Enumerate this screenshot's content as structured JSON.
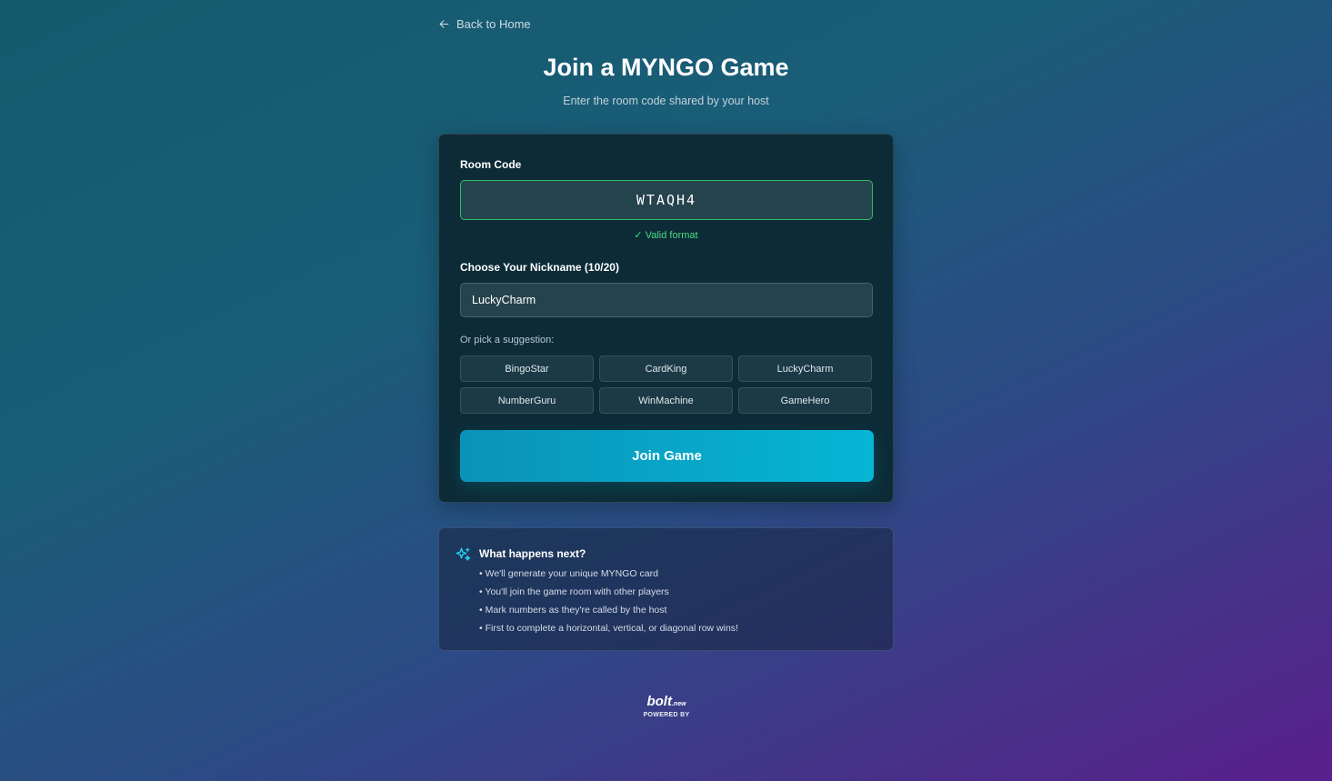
{
  "nav": {
    "back_label": "Back to Home",
    "back_icon": "arrow-left-icon"
  },
  "header": {
    "title": "Join a MYNGO Game",
    "subtitle": "Enter the room code shared by your host"
  },
  "form": {
    "room_code_label": "Room Code",
    "room_code_value": "WTAQH4",
    "valid_message": "✓ Valid format",
    "nickname_label": "Choose Your Nickname (10/20)",
    "nickname_value": "LuckyCharm",
    "suggestion_label": "Or pick a suggestion:",
    "suggestions": [
      "BingoStar",
      "CardKing",
      "LuckyCharm",
      "NumberGuru",
      "WinMachine",
      "GameHero"
    ],
    "join_button": "Join Game"
  },
  "info": {
    "icon": "sparkles-icon",
    "title": "What happens next?",
    "items": [
      "• We'll generate your unique MYNGO card",
      "• You'll join the game room with other players",
      "• Mark numbers as they're called by the host",
      "• First to complete a horizontal, vertical, or diagonal row wins!"
    ]
  },
  "badge": {
    "logo_main": "bolt",
    "logo_sub": ".new",
    "caption": "POWERED BY"
  },
  "colors": {
    "accent": "#06b6d4",
    "valid": "#4ade80",
    "card_bg": "#0c2b37"
  }
}
